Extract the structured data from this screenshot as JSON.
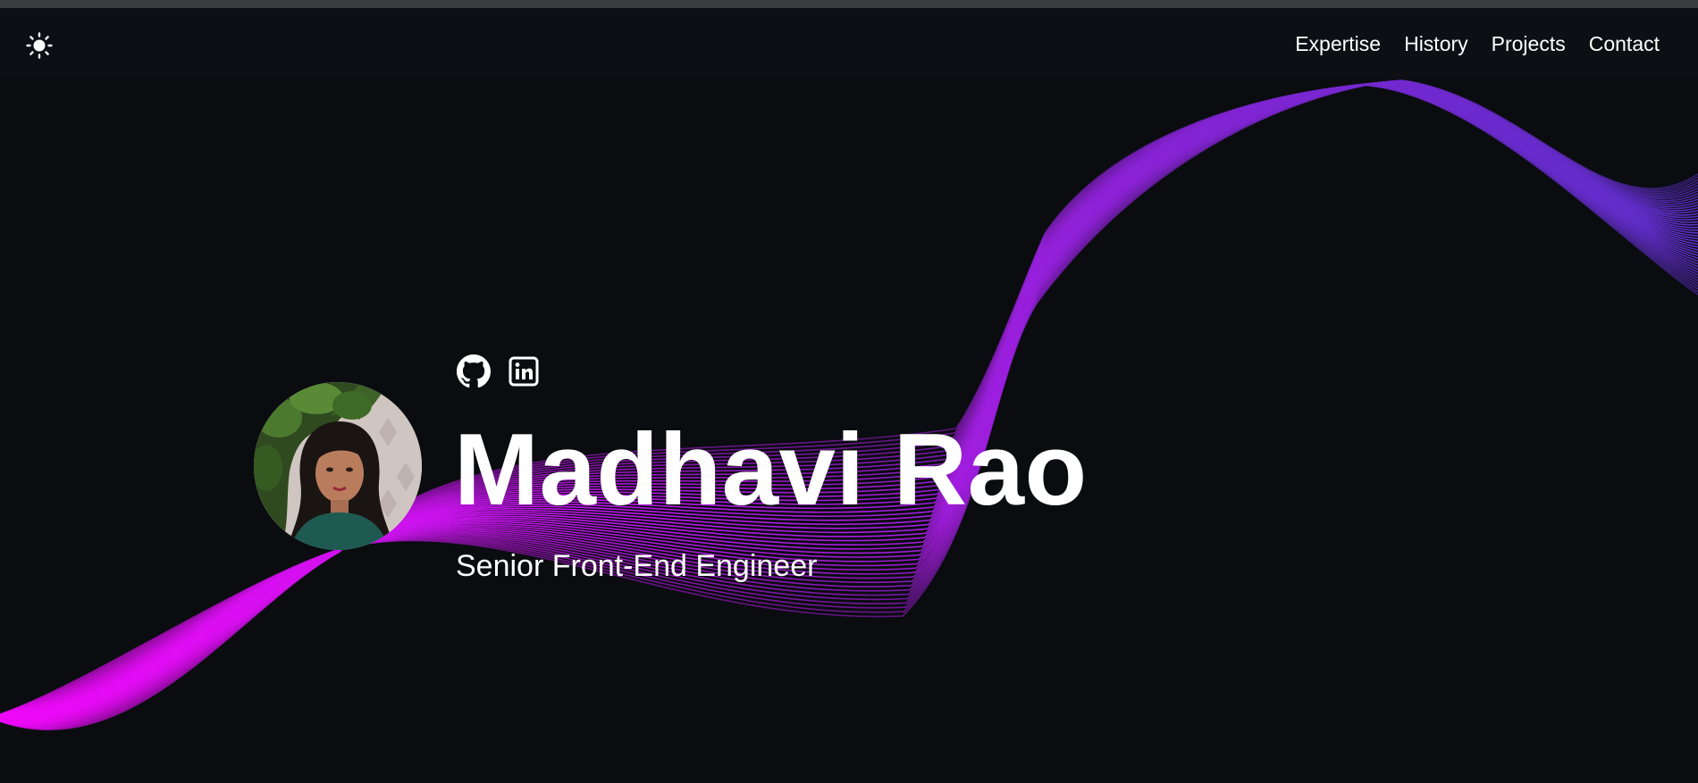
{
  "nav": {
    "theme_icon": "sun-icon",
    "links": [
      {
        "label": "Expertise"
      },
      {
        "label": "History"
      },
      {
        "label": "Projects"
      },
      {
        "label": "Contact"
      }
    ]
  },
  "hero": {
    "name": "Madhavi Rao",
    "role": "Senior Front-End Engineer",
    "socials": [
      {
        "icon": "github-icon"
      },
      {
        "icon": "linkedin-icon"
      }
    ]
  },
  "colors": {
    "background": "#0a0c10",
    "navbar": "#0d0f14",
    "wave_magenta": "#e70bf5",
    "wave_purple": "#8a22d6",
    "wave_violet": "#5a2fc9",
    "text": "#ffffff"
  }
}
